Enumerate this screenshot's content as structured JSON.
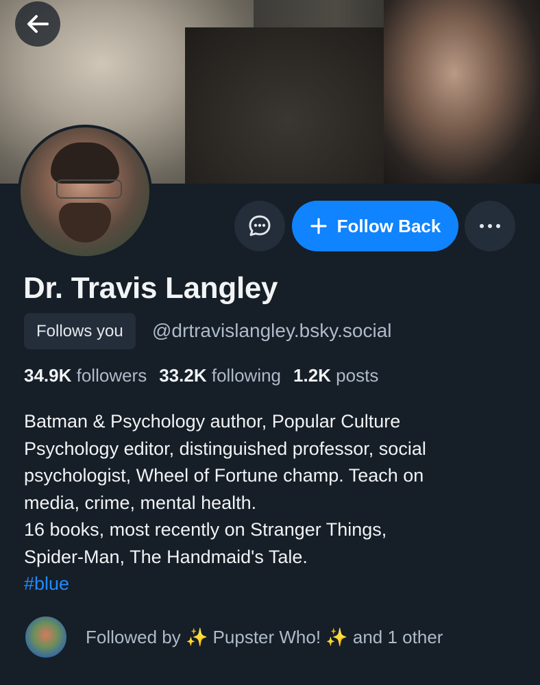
{
  "header": {
    "back_icon": "arrow-left-icon"
  },
  "actions": {
    "message_icon": "chat-bubble-icon",
    "follow_label": "Follow Back",
    "follow_icon": "plus-icon",
    "more_icon": "ellipsis-icon"
  },
  "profile": {
    "display_name": "Dr. Travis Langley",
    "follows_you": "Follows you",
    "handle": "@drtravislangley.bsky.social",
    "followers_count": "34.9K",
    "followers_label": "followers",
    "following_count": "33.2K",
    "following_label": "following",
    "posts_count": "1.2K",
    "posts_label": "posts",
    "bio_lines": [
      "Batman & Psychology author, Popular Culture",
      "Psychology editor, distinguished professor, social",
      "psychologist, Wheel of Fortune champ. Teach on",
      "media, crime, mental health.",
      "16 books, most recently on Stranger Things,",
      "Spider-Man, The Handmaid's Tale."
    ],
    "hashtag": "#blue"
  },
  "followed_by": {
    "text": "Followed by ✨ Pupster Who! ✨ and 1 other"
  },
  "colors": {
    "background": "#161e27",
    "accent": "#1083fe",
    "secondary_text": "#aebbc9"
  }
}
